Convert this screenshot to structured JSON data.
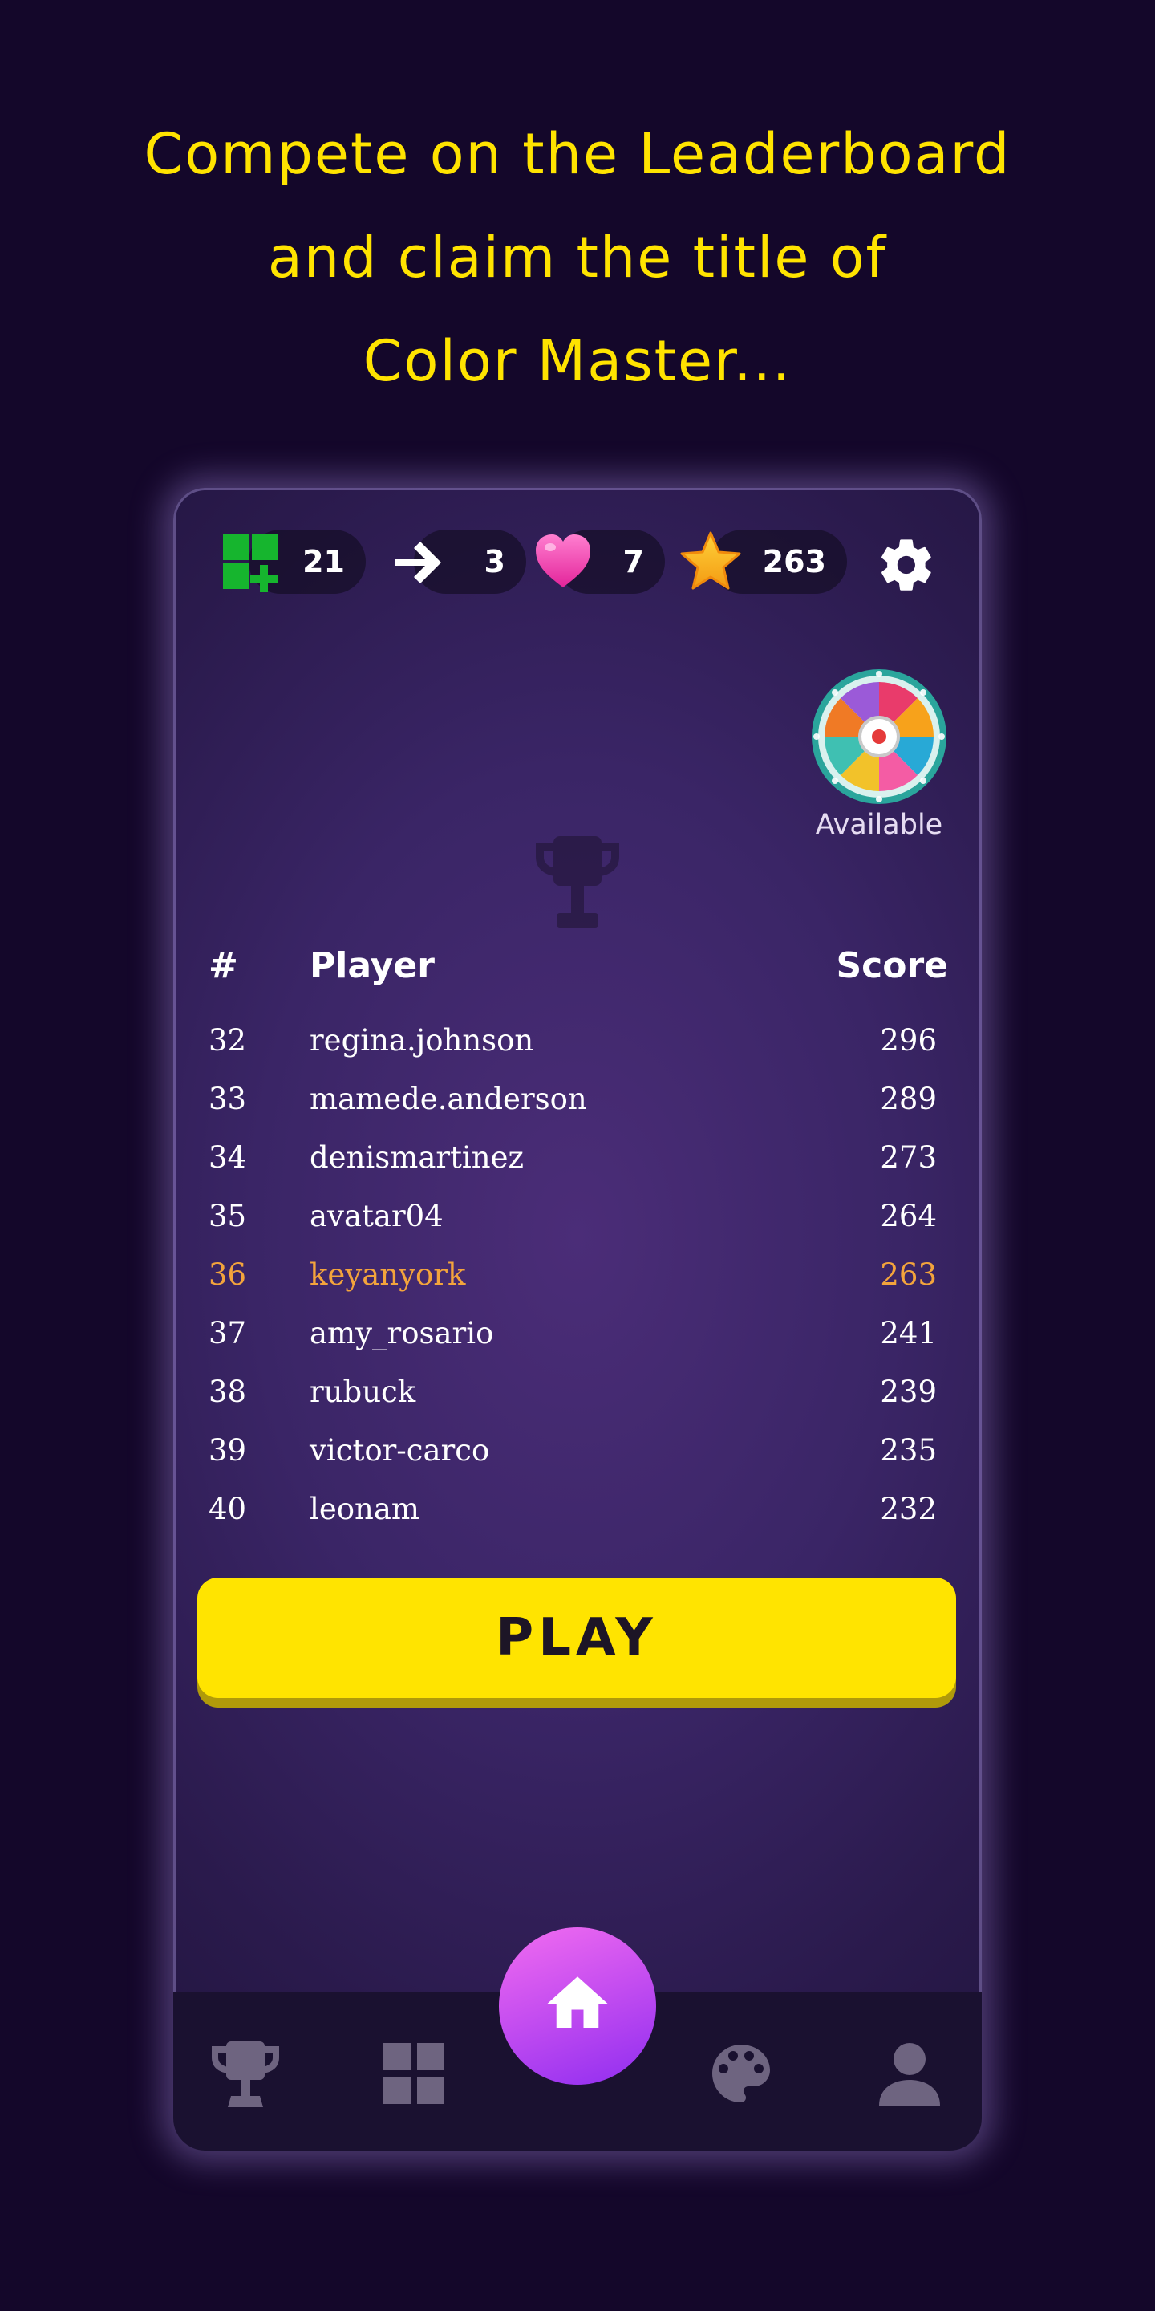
{
  "headline": {
    "line1": "Compete on the Leaderboard",
    "line2": "and claim the title of",
    "line3": "Color Master..."
  },
  "colors": {
    "background": "#14072a",
    "accent_yellow": "#ffe300",
    "highlight_orange": "#f3a43c",
    "home_gradient_start": "#f26cf0",
    "home_gradient_end": "#8f2df0"
  },
  "stats": {
    "blocks": {
      "icon": "green-blocks-plus-icon",
      "value": "21"
    },
    "moves": {
      "icon": "arrow-right-icon",
      "value": "3"
    },
    "lives": {
      "icon": "pink-heart-icon",
      "value": "7"
    },
    "stars": {
      "icon": "gold-star-icon",
      "value": "263"
    },
    "settings": {
      "icon": "gear-icon"
    }
  },
  "wheel": {
    "icon": "prize-wheel-icon",
    "status": "Available"
  },
  "leaderboard": {
    "icon": "trophy-icon",
    "headers": {
      "rank": "#",
      "player": "Player",
      "score": "Score"
    },
    "rows": [
      {
        "rank": "32",
        "player": "regina.johnson",
        "score": "296"
      },
      {
        "rank": "33",
        "player": "mamede.anderson",
        "score": "289"
      },
      {
        "rank": "34",
        "player": "denismartinez",
        "score": "273"
      },
      {
        "rank": "35",
        "player": "avatar04",
        "score": "264"
      },
      {
        "rank": "36",
        "player": "keyanyork",
        "score": "263",
        "current_user": true
      },
      {
        "rank": "37",
        "player": "amy_rosario",
        "score": "241"
      },
      {
        "rank": "38",
        "player": "rubuck",
        "score": "239"
      },
      {
        "rank": "39",
        "player": "victor-carco",
        "score": "235"
      },
      {
        "rank": "40",
        "player": "leonam",
        "score": "232"
      }
    ]
  },
  "play_button": {
    "label": "PLAY"
  },
  "nav": {
    "items": [
      {
        "icon": "trophy-icon"
      },
      {
        "icon": "grid-icon"
      },
      {
        "icon": "home-icon",
        "active": true
      },
      {
        "icon": "palette-icon"
      },
      {
        "icon": "profile-icon"
      }
    ]
  }
}
